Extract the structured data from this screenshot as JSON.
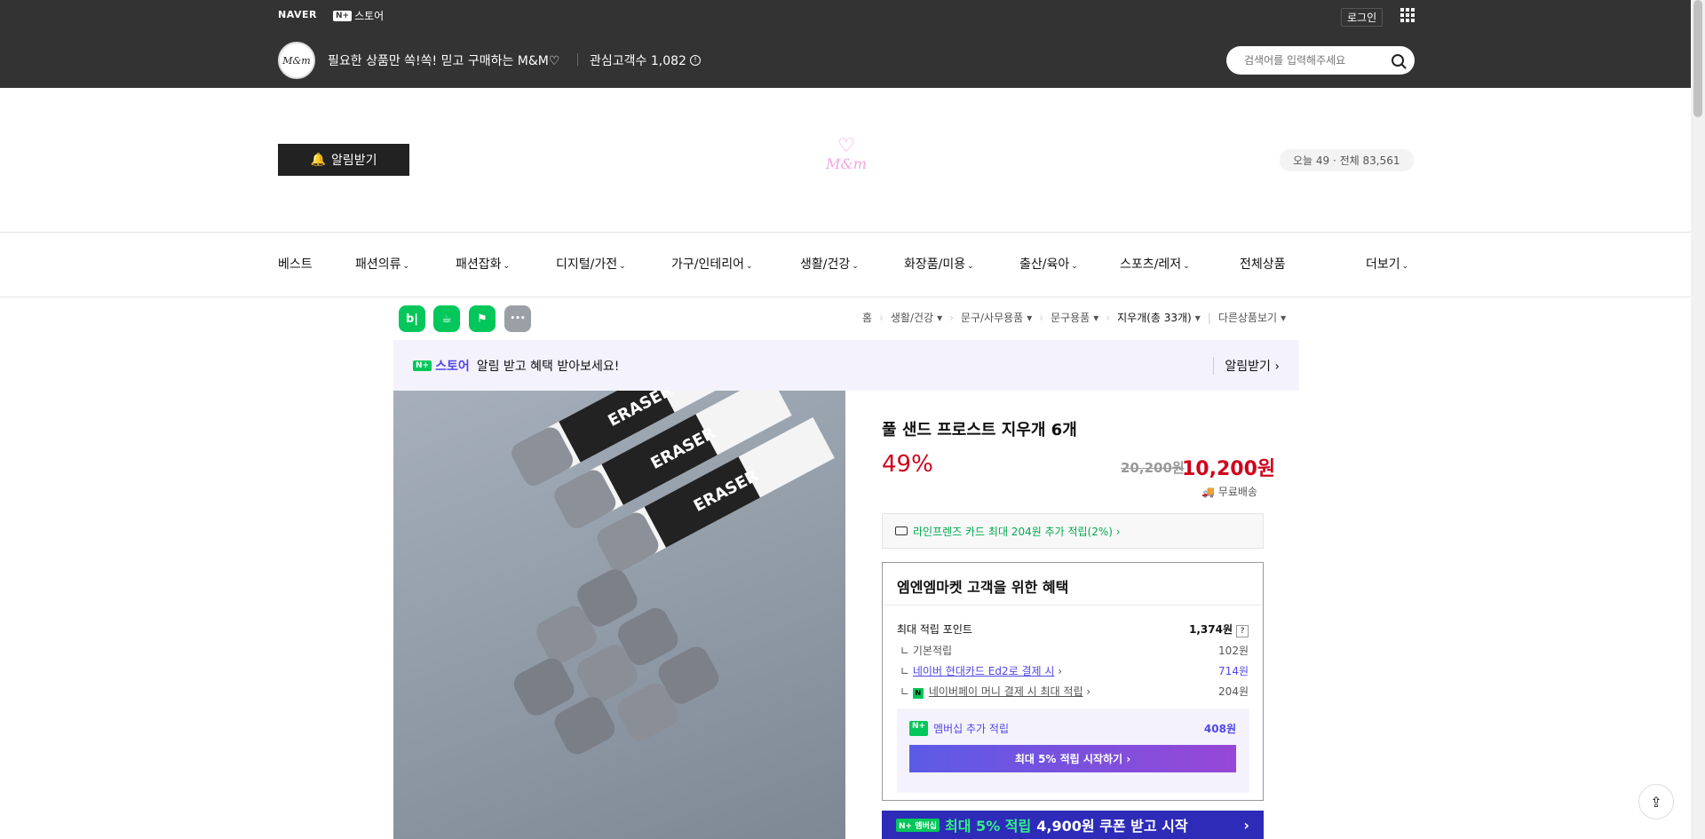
{
  "topbar": {
    "naver": "NAVER",
    "np_box": "N+",
    "np_label": "스토어",
    "login": "로그인",
    "store_logo_text": "M&m",
    "store_title": "필요한 상품만 쏙!쏙! 믿고 구매하는 M&M♡",
    "fav_label": "관심고객수 1,082",
    "search_placeholder": "검색어를 입력해주세요"
  },
  "header": {
    "alarm": "알림받기",
    "logo_text": "M&m",
    "visitors": "오늘 49 · 전체 83,561"
  },
  "nav": {
    "items": [
      "베스트",
      "패션의류",
      "패션잡화",
      "디지털/가전",
      "가구/인테리어",
      "생활/건강",
      "화장품/미용",
      "출산/육아",
      "스포츠/레저",
      "전체상품"
    ],
    "more": "더보기"
  },
  "sns": [
    {
      "label": "b|",
      "color": "#03c75a"
    },
    {
      "label": "☕",
      "color": "#03c75a"
    },
    {
      "label": "⚑",
      "color": "#03c75a"
    },
    {
      "label": "•••",
      "color": "#9aa0a6"
    }
  ],
  "breadcrumb": {
    "home": "홈",
    "c1": "생활/건강",
    "c2": "문구/사무용품",
    "c3": "문구용품",
    "c4": "지우개(총 33개)",
    "other": "다른상품보기"
  },
  "notice": {
    "np_box": "N+",
    "brand": "스토어",
    "text": "알림 받고 혜택 받아보세요!",
    "action": "알림받기 ›"
  },
  "product": {
    "title": "풀 샌드 프로스트 지우개 6개",
    "discount": "49%",
    "original_price": "20,200원",
    "sale_price": "10,200원",
    "shipping": "무료배송",
    "card_promo": "라인프렌즈 카드 최대 204원 추가 적립(2%) ›",
    "image_text": "ERASER"
  },
  "benefits": {
    "title": "엠엔엠마켓 고객을 위한 혜택",
    "max_points_label": "최대 적립 포인트",
    "max_points_value": "1,374원",
    "rows": [
      {
        "label": "기본적립",
        "value": "102원"
      },
      {
        "label": "네이버 현대카드 Ed2로 결제 시",
        "value": "714원"
      },
      {
        "label": "네이버페이 머니 결제 시 최대 적립",
        "value": "204원"
      }
    ],
    "membership_np": "N+",
    "membership_label": "멤버십 추가 적립",
    "membership_value": "408원",
    "membership_button": "최대 5% 적립 시작하기 ›"
  },
  "coupon": {
    "np": "N+ 멤버십",
    "text_green": "최대 5% 적립",
    "text_white": "4,900원 쿠폰 받고 시작",
    "chev": "›"
  }
}
